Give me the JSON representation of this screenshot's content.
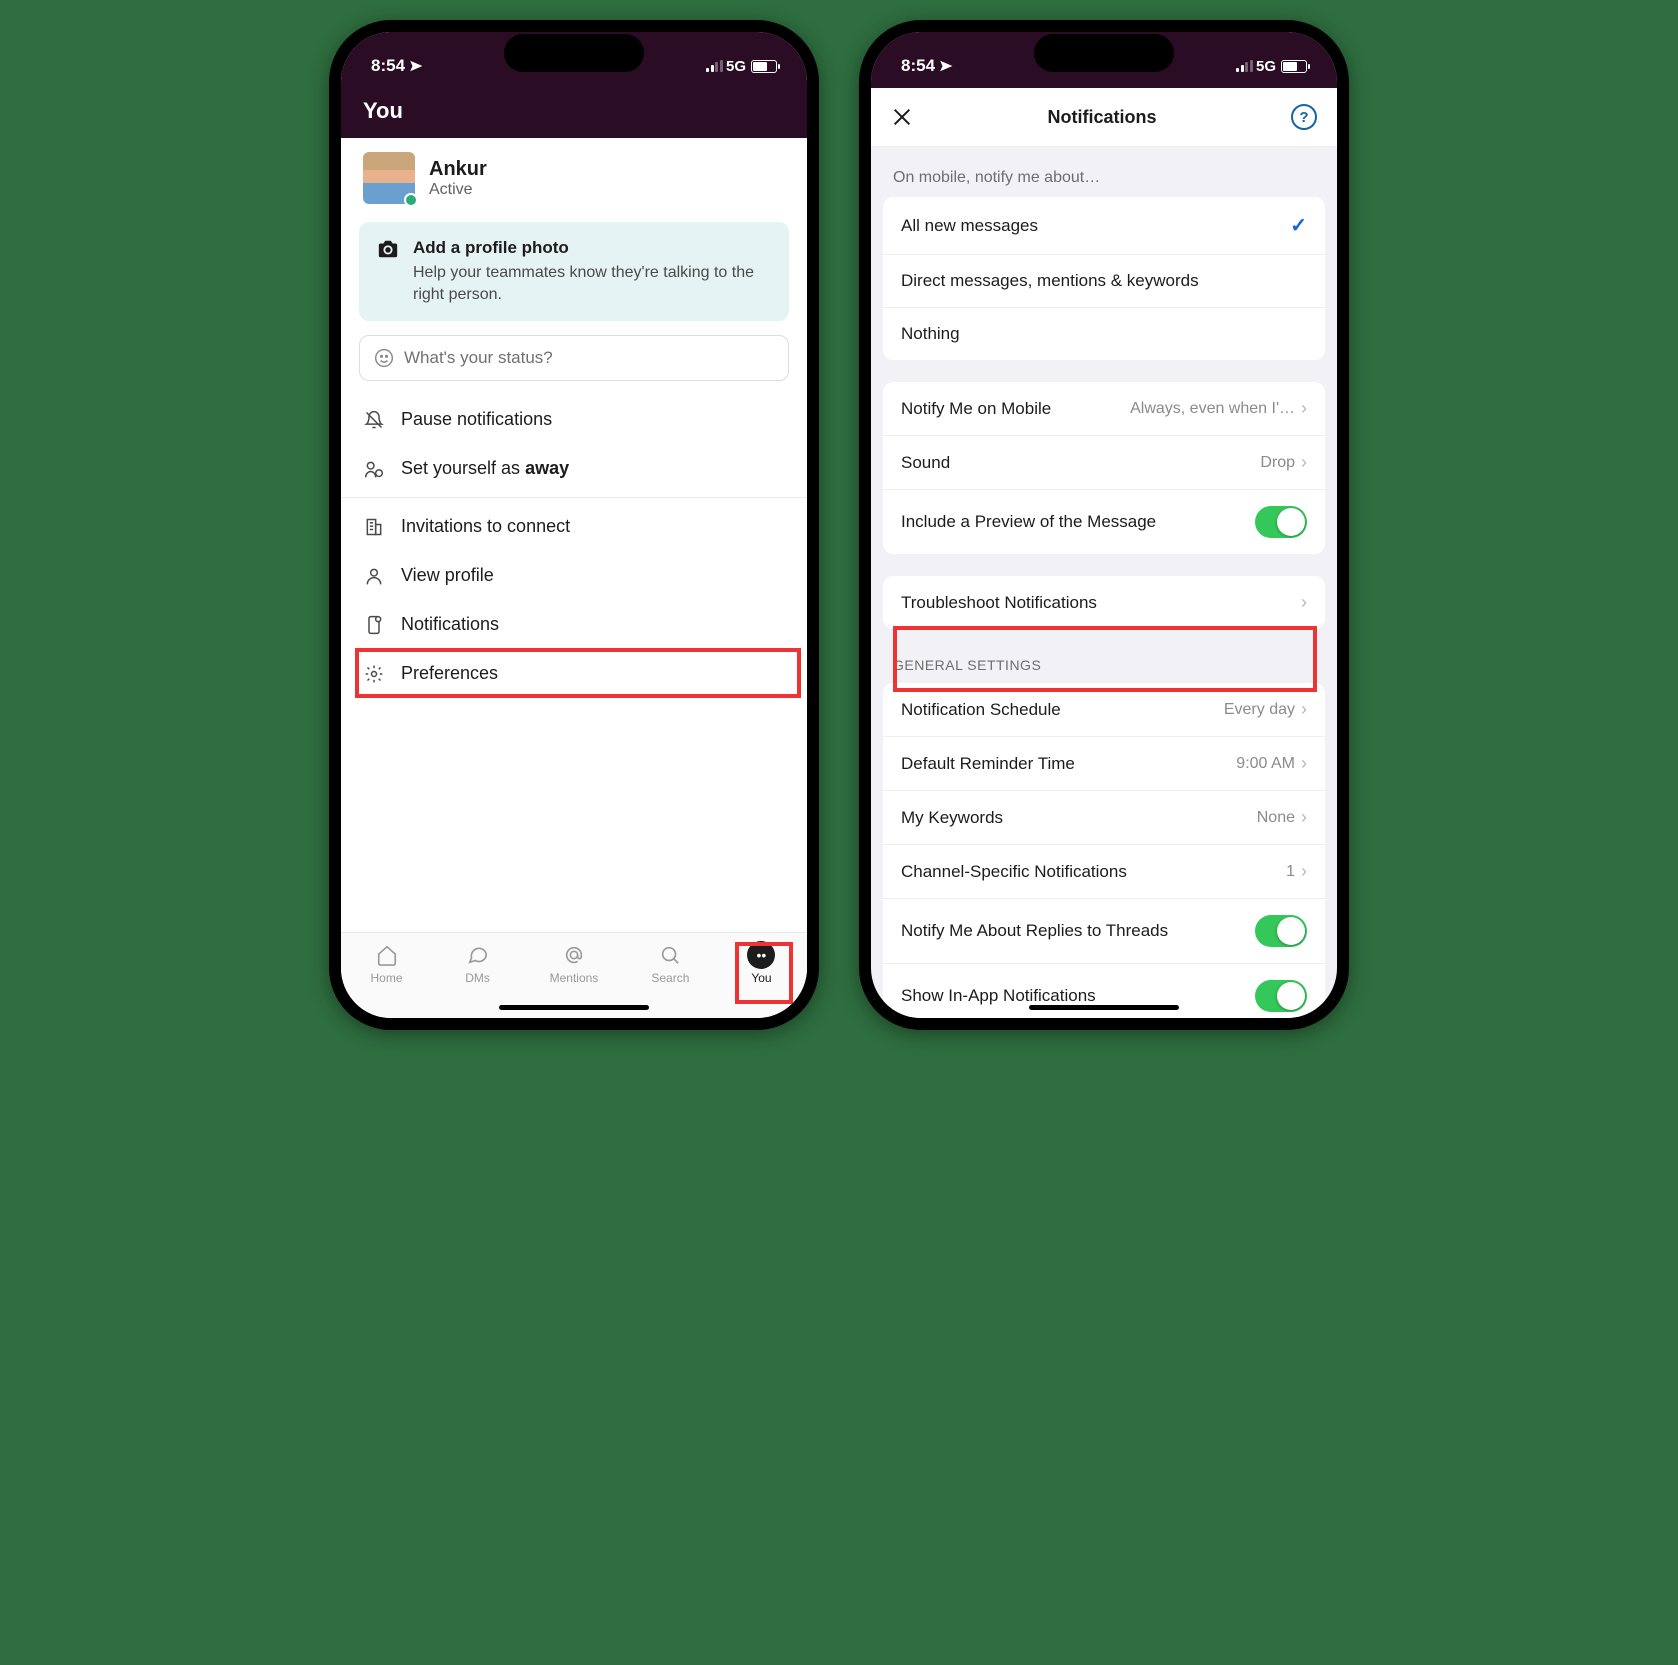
{
  "status": {
    "time": "8:54",
    "network": "5G"
  },
  "phone1": {
    "headerTitle": "You",
    "profile": {
      "name": "Ankur",
      "presence": "Active"
    },
    "banner": {
      "title": "Add a profile photo",
      "subtitle": "Help your teammates know they're talking to the right person."
    },
    "statusPlaceholder": "What's your status?",
    "menu": {
      "pause": "Pause notifications",
      "awayPrefix": "Set yourself as ",
      "awayBold": "away",
      "invitations": "Invitations to connect",
      "viewProfile": "View profile",
      "notifications": "Notifications",
      "preferences": "Preferences"
    },
    "tabs": {
      "home": "Home",
      "dms": "DMs",
      "mentions": "Mentions",
      "search": "Search",
      "you": "You"
    }
  },
  "phone2": {
    "title": "Notifications",
    "sectionNotify": "On mobile, notify me about…",
    "opts": {
      "all": "All new messages",
      "dm": "Direct messages, mentions & keywords",
      "nothing": "Nothing"
    },
    "rows": {
      "notifyMobile": {
        "label": "Notify Me on Mobile",
        "value": "Always, even when I'…"
      },
      "sound": {
        "label": "Sound",
        "value": "Drop"
      },
      "preview": {
        "label": "Include a Preview of the Message"
      },
      "troubleshoot": "Troubleshoot Notifications"
    },
    "generalLabel": "General Settings",
    "general": {
      "schedule": {
        "label": "Notification Schedule",
        "value": "Every day"
      },
      "reminder": {
        "label": "Default Reminder Time",
        "value": "9:00 AM"
      },
      "keywords": {
        "label": "My Keywords",
        "value": "None"
      },
      "channel": {
        "label": "Channel-Specific Notifications",
        "value": "1"
      },
      "threads": {
        "label": "Notify Me About Replies to Threads"
      },
      "inapp": {
        "label": "Show In-App Notifications"
      }
    }
  }
}
